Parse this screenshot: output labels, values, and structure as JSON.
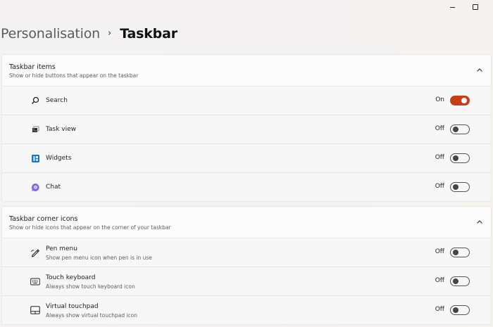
{
  "window": {
    "minimize_icon": "minimize-icon",
    "maximize_icon": "maximize-icon"
  },
  "breadcrumb": {
    "parent": "Personalisation",
    "separator": "›",
    "current": "Taskbar"
  },
  "sections": [
    {
      "title": "Taskbar items",
      "subtitle": "Show or hide buttons that appear on the taskbar",
      "expanded": true,
      "items": [
        {
          "label": "Search",
          "icon": "search-icon",
          "state": "On",
          "on": true
        },
        {
          "label": "Task view",
          "icon": "task-view-icon",
          "state": "Off",
          "on": false
        },
        {
          "label": "Widgets",
          "icon": "widgets-icon",
          "state": "Off",
          "on": false
        },
        {
          "label": "Chat",
          "icon": "chat-icon",
          "state": "Off",
          "on": false
        }
      ]
    },
    {
      "title": "Taskbar corner icons",
      "subtitle": "Show or hide icons that appear on the corner of your taskbar",
      "expanded": true,
      "items": [
        {
          "label": "Pen menu",
          "description": "Show pen menu icon when pen is in use",
          "icon": "pen-icon",
          "state": "Off",
          "on": false
        },
        {
          "label": "Touch keyboard",
          "description": "Always show touch keyboard icon",
          "icon": "keyboard-icon",
          "state": "Off",
          "on": false
        },
        {
          "label": "Virtual touchpad",
          "description": "Always show virtual touchpad icon",
          "icon": "touchpad-icon",
          "state": "Off",
          "on": false
        }
      ]
    }
  ],
  "colors": {
    "accent": "#c73d18",
    "background": "#f3f1f2"
  }
}
